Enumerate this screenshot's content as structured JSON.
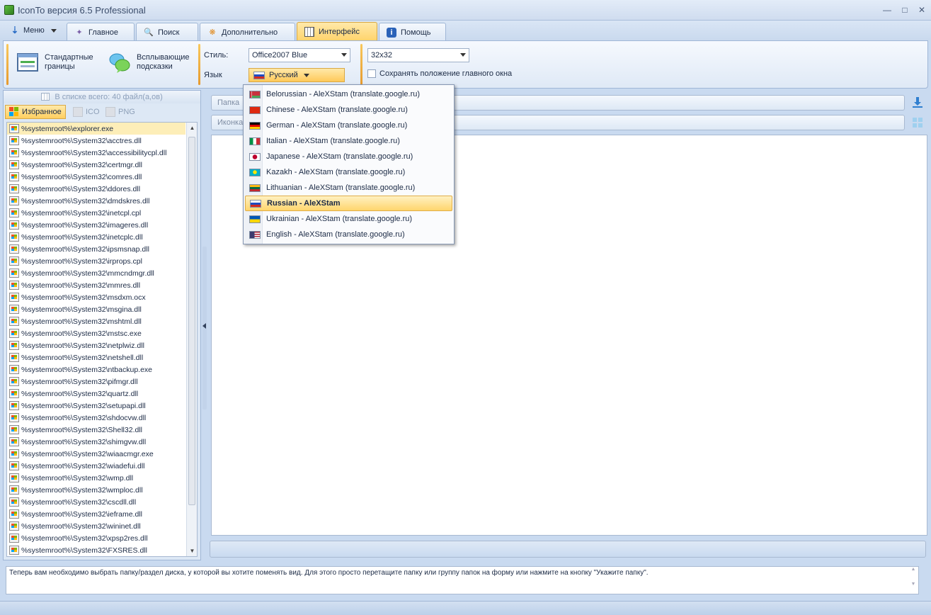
{
  "window": {
    "title": "IconTo версия 6.5 Professional"
  },
  "tabs": {
    "menu": "Меню",
    "items": [
      {
        "label": "Главное",
        "icon": "wand-icon"
      },
      {
        "label": "Поиск",
        "icon": "search-icon"
      },
      {
        "label": "Дополнительно",
        "icon": "puzzle-icon"
      },
      {
        "label": "Интерфейс",
        "icon": "interface-grid-icon"
      },
      {
        "label": "Помощь",
        "icon": "info-shield-icon"
      }
    ]
  },
  "ribbon": {
    "standard_borders": "Стандартные границы",
    "standard_borders_line1": "Стандартные",
    "standard_borders_line2": "границы",
    "tooltips_line1": "Всплывающие",
    "tooltips_line2": "подсказки",
    "style_label": "Стиль:",
    "style_value": "Office2007 Blue",
    "language_label": "Язык",
    "language_value": "Русский",
    "size_value": "32x32",
    "save_position_label": "Сохранять положение главного окна"
  },
  "left_panel": {
    "count_text": "В списке всего: 40 файл(а,ов)",
    "tabs": [
      "Избранное",
      "ICO",
      "PNG"
    ],
    "files": [
      "%systemroot%\\explorer.exe",
      "%systemroot%\\System32\\acctres.dll",
      "%systemroot%\\System32\\accessibilitycpl.dll",
      "%systemroot%\\System32\\certmgr.dll",
      "%systemroot%\\System32\\comres.dll",
      "%systemroot%\\System32\\ddores.dll",
      "%systemroot%\\System32\\dmdskres.dll",
      "%systemroot%\\System32\\inetcpl.cpl",
      "%systemroot%\\System32\\imageres.dll",
      "%systemroot%\\System32\\inetcplc.dll",
      "%systemroot%\\System32\\ipsmsnap.dll",
      "%systemroot%\\System32\\irprops.cpl",
      "%systemroot%\\System32\\mmcndmgr.dll",
      "%systemroot%\\System32\\mmres.dll",
      "%systemroot%\\System32\\msdxm.ocx",
      "%systemroot%\\System32\\msgina.dll",
      "%systemroot%\\System32\\mshtml.dll",
      "%systemroot%\\System32\\mstsc.exe",
      "%systemroot%\\System32\\netplwiz.dll",
      "%systemroot%\\System32\\netshell.dll",
      "%systemroot%\\System32\\ntbackup.exe",
      "%systemroot%\\System32\\pifmgr.dll",
      "%systemroot%\\System32\\quartz.dll",
      "%systemroot%\\System32\\setupapi.dll",
      "%systemroot%\\System32\\shdocvw.dll",
      "%systemroot%\\System32\\Shell32.dll",
      "%systemroot%\\System32\\shimgvw.dll",
      "%systemroot%\\System32\\wiaacmgr.exe",
      "%systemroot%\\System32\\wiadefui.dll",
      "%systemroot%\\System32\\wmp.dll",
      "%systemroot%\\System32\\wmploc.dll",
      "%systemroot%\\System32\\cscdll.dll",
      "%systemroot%\\System32\\ieframe.dll",
      "%systemroot%\\System32\\wininet.dll",
      "%systemroot%\\System32\\xpsp2res.dll",
      "%systemroot%\\System32\\FXSRES.dll"
    ]
  },
  "main": {
    "folder_field": "Папка",
    "icon_field": "Иконка"
  },
  "language_dropdown": {
    "items": [
      {
        "label": "Belorussian - AleXStam (translate.google.ru)",
        "flag": "by"
      },
      {
        "label": "Chinese - AleXStam (translate.google.ru)",
        "flag": "cn"
      },
      {
        "label": "German - AleXStam (translate.google.ru)",
        "flag": "de"
      },
      {
        "label": "Italian - AleXStam (translate.google.ru)",
        "flag": "it"
      },
      {
        "label": "Japanese - AleXStam (translate.google.ru)",
        "flag": "jp"
      },
      {
        "label": "Kazakh - AleXStam (translate.google.ru)",
        "flag": "kz"
      },
      {
        "label": "Lithuanian - AleXStam (translate.google.ru)",
        "flag": "lt"
      },
      {
        "label": "Russian - AleXStam",
        "flag": "ru",
        "selected": true
      },
      {
        "label": "Ukrainian - AleXStam (translate.google.ru)",
        "flag": "ua"
      },
      {
        "label": "English - AleXStam (translate.google.ru)",
        "flag": "us"
      }
    ]
  },
  "hint": {
    "text": "Теперь вам необходимо выбрать папку/раздел диска, у которой вы хотите поменять вид. Для этого просто перетащите папку или группу папок на форму или нажмите на кнопку \"Укажите папку\"."
  },
  "colors": {
    "accent_orange": "#ffd36a",
    "frame_blue": "#c9daf0",
    "selection": "#fdeeb8"
  }
}
